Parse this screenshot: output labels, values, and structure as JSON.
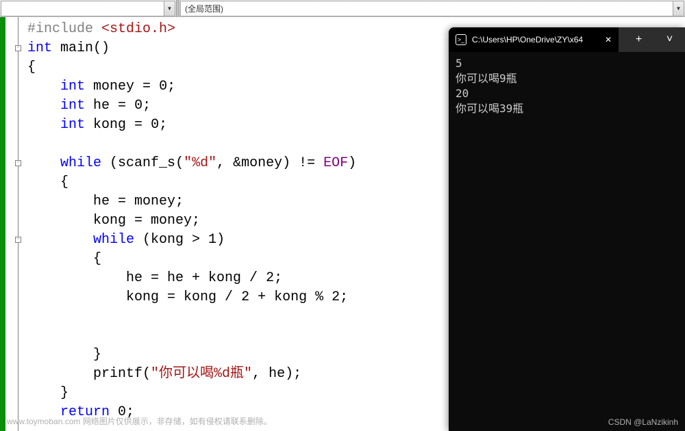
{
  "header": {
    "scope_text": "(全局范围)"
  },
  "code": {
    "lines": [
      {
        "tokens": [
          [
            "pp",
            "#include "
          ],
          [
            "hdr",
            "<stdio.h>"
          ]
        ]
      },
      {
        "tokens": [
          [
            "kw",
            "int "
          ],
          [
            "fn",
            "main"
          ],
          [
            "op",
            "()"
          ]
        ]
      },
      {
        "tokens": [
          [
            "op",
            "{"
          ]
        ]
      },
      {
        "tokens": [
          [
            "",
            "    "
          ],
          [
            "kw",
            "int "
          ],
          [
            "id",
            "money "
          ],
          [
            "op",
            "= "
          ],
          [
            "num",
            "0"
          ],
          [
            "op",
            ";"
          ]
        ]
      },
      {
        "tokens": [
          [
            "",
            "    "
          ],
          [
            "kw",
            "int "
          ],
          [
            "id",
            "he "
          ],
          [
            "op",
            "= "
          ],
          [
            "num",
            "0"
          ],
          [
            "op",
            ";"
          ]
        ]
      },
      {
        "tokens": [
          [
            "",
            "    "
          ],
          [
            "kw",
            "int "
          ],
          [
            "id",
            "kong "
          ],
          [
            "op",
            "= "
          ],
          [
            "num",
            "0"
          ],
          [
            "op",
            ";"
          ]
        ]
      },
      {
        "tokens": [
          [
            "",
            ""
          ]
        ]
      },
      {
        "tokens": [
          [
            "",
            "    "
          ],
          [
            "kw",
            "while "
          ],
          [
            "op",
            "("
          ],
          [
            "fn",
            "scanf_s"
          ],
          [
            "op",
            "("
          ],
          [
            "str",
            "\"%d\""
          ],
          [
            "op",
            ", &money) != "
          ],
          [
            "scanfk",
            "EOF"
          ],
          [
            "op",
            ")"
          ]
        ]
      },
      {
        "tokens": [
          [
            "",
            "    "
          ],
          [
            "op",
            "{"
          ]
        ]
      },
      {
        "tokens": [
          [
            "",
            "        "
          ],
          [
            "id",
            "he = money"
          ],
          [
            "op",
            ";"
          ]
        ]
      },
      {
        "tokens": [
          [
            "",
            "        "
          ],
          [
            "id",
            "kong = money"
          ],
          [
            "op",
            ";"
          ]
        ]
      },
      {
        "tokens": [
          [
            "",
            "        "
          ],
          [
            "kw",
            "while "
          ],
          [
            "op",
            "(kong > "
          ],
          [
            "num",
            "1"
          ],
          [
            "op",
            ")"
          ]
        ]
      },
      {
        "tokens": [
          [
            "",
            "        "
          ],
          [
            "op",
            "{"
          ]
        ]
      },
      {
        "tokens": [
          [
            "",
            "            "
          ],
          [
            "id",
            "he = he + kong / "
          ],
          [
            "num",
            "2"
          ],
          [
            "op",
            ";"
          ]
        ]
      },
      {
        "tokens": [
          [
            "",
            "            "
          ],
          [
            "id",
            "kong = kong / "
          ],
          [
            "num",
            "2"
          ],
          [
            "op",
            " + kong % "
          ],
          [
            "num",
            "2"
          ],
          [
            "op",
            ";"
          ]
        ]
      },
      {
        "tokens": [
          [
            "",
            ""
          ]
        ]
      },
      {
        "tokens": [
          [
            "",
            ""
          ]
        ]
      },
      {
        "tokens": [
          [
            "",
            "        "
          ],
          [
            "op",
            "}"
          ]
        ]
      },
      {
        "tokens": [
          [
            "",
            "        "
          ],
          [
            "fn",
            "printf"
          ],
          [
            "op",
            "("
          ],
          [
            "str",
            "\"你可以喝%d瓶\""
          ],
          [
            "op",
            ", he);"
          ]
        ]
      },
      {
        "tokens": [
          [
            "",
            "    "
          ],
          [
            "op",
            "}"
          ]
        ]
      },
      {
        "tokens": [
          [
            "",
            "    "
          ],
          [
            "kw",
            "return "
          ],
          [
            "num",
            "0"
          ],
          [
            "op",
            ";"
          ]
        ]
      }
    ]
  },
  "fold_markers": [
    {
      "row": 1,
      "symbol": "-"
    },
    {
      "row": 7,
      "symbol": "-"
    },
    {
      "row": 11,
      "symbol": "-"
    }
  ],
  "terminal": {
    "title": "C:\\Users\\HP\\OneDrive\\ZY\\x64",
    "plus": "+",
    "chevron": "˅",
    "output": [
      "5",
      "你可以喝9瓶",
      "20",
      "你可以喝39瓶"
    ]
  },
  "watermark": {
    "left": "www.toymoban.com  网络图片仅供展示，非存储，如有侵权请联系删除。",
    "right": "CSDN @LaNzikinh"
  }
}
